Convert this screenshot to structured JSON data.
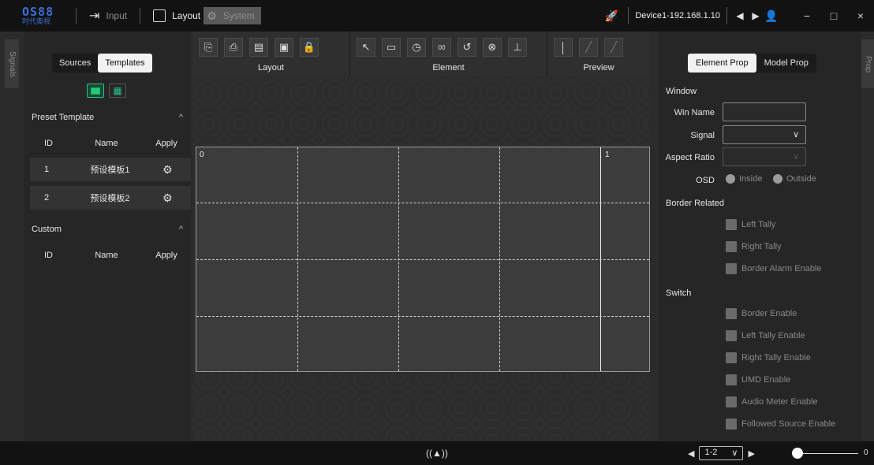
{
  "titlebar": {
    "logo_top": "OS88",
    "logo_bottom": "时代奥视",
    "menu": {
      "input": "Input",
      "layout": "Layout",
      "system": "System"
    },
    "device": "Device1-192.168.1.10",
    "minimize": "−",
    "maximize": "□",
    "close": "×"
  },
  "side_tabs": {
    "left": "Signals",
    "right": "Prop"
  },
  "left_panel": {
    "tabs": [
      "Sources",
      "Templates"
    ],
    "preset_section": "Preset Template",
    "custom_section": "Custom",
    "columns": {
      "id": "ID",
      "name": "Name",
      "apply": "Apply"
    },
    "presets": [
      {
        "id": "1",
        "name": "预设模板1"
      },
      {
        "id": "2",
        "name": "预设模板2"
      }
    ]
  },
  "toolbar": {
    "groups": {
      "layout": "Layout",
      "element": "Element",
      "preview": "Preview"
    }
  },
  "canvas": {
    "labels": {
      "left": "0",
      "right": "1"
    }
  },
  "right_panel": {
    "tabs": [
      "Element Prop",
      "Model Prop"
    ],
    "window_section": "Window",
    "win_name_label": "Win Name",
    "signal_label": "Signal",
    "aspect_ratio_label": "Aspect Ratio",
    "osd_label": "OSD",
    "osd_inside": "Inside",
    "osd_outside": "Outside",
    "border_section": "Border Related",
    "left_tally": "Left Tally",
    "right_tally": "Right Tally",
    "border_alarm": "Border Alarm Enable",
    "switch_section": "Switch",
    "border_enable": "Border Enable",
    "left_tally_enable": "Left Tally Enable",
    "right_tally_enable": "Right Tally Enable",
    "umd_enable": "UMD Enable",
    "audio_meter_enable": "Audio Meter Enable",
    "followed_source_enable": "Followed Source Enable"
  },
  "statusbar": {
    "page": "1-2",
    "zoom": "0"
  },
  "colors": {
    "accent_green": "#2ac28f",
    "brand_blue": "#3b6fd8"
  }
}
